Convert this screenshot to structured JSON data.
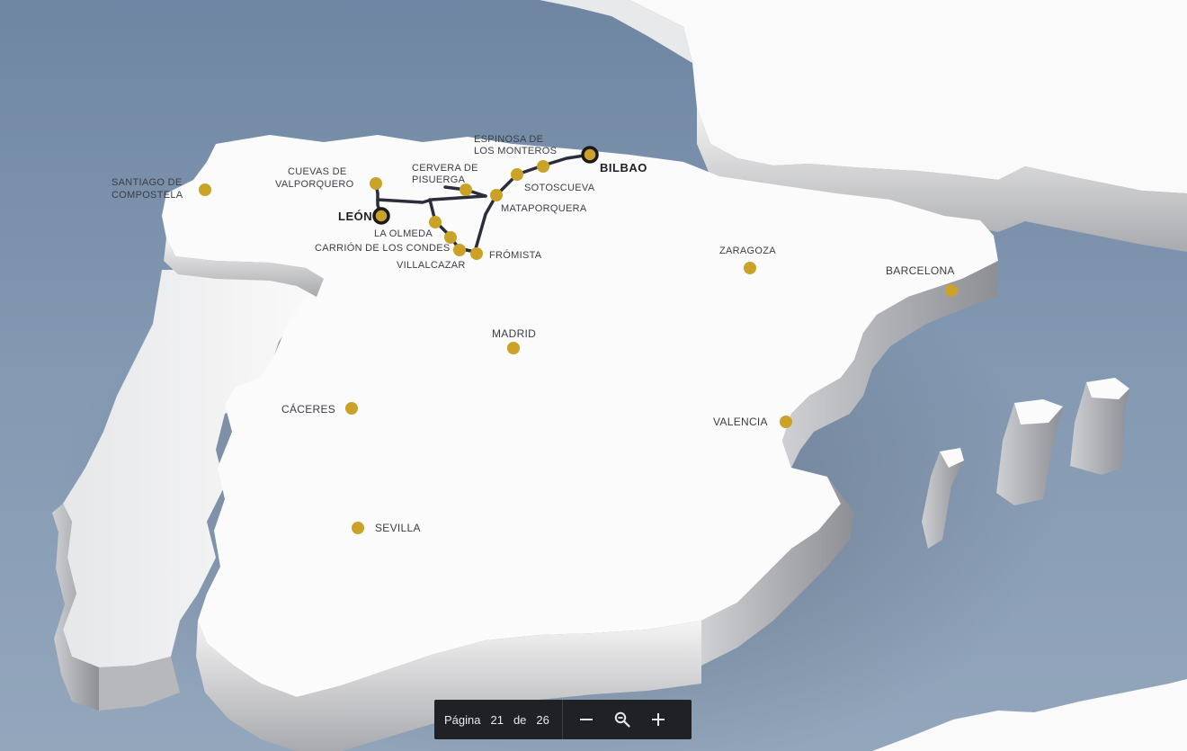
{
  "map": {
    "route_color": "#2a2d3a",
    "marker_color": "#c9a227",
    "cities": {
      "santiago": {
        "line1": "SANTIAGO DE",
        "line2": "COMPOSTELA"
      },
      "cuevas": {
        "line1": "CUEVAS DE",
        "line2": "VALPORQUERO"
      },
      "cervera": {
        "line1": "CERVERA DE",
        "line2": "PISUERGA"
      },
      "espinosa": {
        "line1": "ESPINOSA DE",
        "line2": "LOS MONTEROS"
      },
      "bilbao": "BILBAO",
      "leon": "LEÓN",
      "sotoscueva": "SOTOSCUEVA",
      "mataporquera": "MATAPORQUERA",
      "la_olmeda": "LA OLMEDA",
      "carrion": "CARRIÓN DE LOS CONDES",
      "villalcazar": "VILLALCAZAR",
      "fromista": "FRÓMISTA",
      "zaragoza": "ZARAGOZA",
      "barcelona": "BARCELONA",
      "madrid": "MADRID",
      "caceres": "CÁCERES",
      "valencia": "VALENCIA",
      "sevilla": "SEVILLA"
    }
  },
  "toolbar": {
    "page_label": "Página",
    "current_page": "21",
    "of_label": "de",
    "total_pages": "26",
    "zoom_out_icon": "minus-icon",
    "zoom_icon": "magnifier-icon",
    "zoom_in_icon": "plus-icon"
  }
}
